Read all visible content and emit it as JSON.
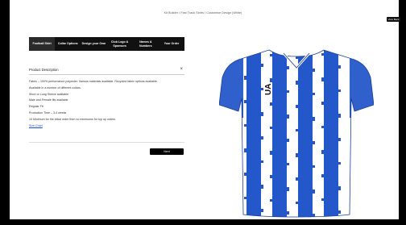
{
  "header": {
    "breadcrumb": "Kit Builder / Fast Track Shirts / Customise Design (White)",
    "back_button": "View Back"
  },
  "tabs": [
    {
      "label": "Football Shirt",
      "active": true
    },
    {
      "label": "Collar Options",
      "active": false
    },
    {
      "label": "Design your Own",
      "active": false
    },
    {
      "label": "Club Logo & Sponsors",
      "active": false
    },
    {
      "label": "Names & Numbers",
      "active": false
    },
    {
      "label": "Your Order",
      "active": false
    }
  ],
  "panel": {
    "title": "Product Description",
    "close_glyph": "×",
    "lines": [
      "Fabric – 100% performance polyester. Various materials available. Recycled fabric options available.",
      "Available in a number of different collars.",
      "Short or Long Sleeve available",
      "Male and Female fits available",
      "Regular Fit",
      "Production Time – 3-4 weeks",
      "10 Minimum for the initial order then no minimums for top up orders."
    ],
    "size_chart_link": "Size Chart"
  },
  "actions": {
    "next_label": "Next"
  },
  "product": {
    "stripe_color": "#2457c9",
    "base_color": "#ffffff",
    "crest_text": "UA"
  }
}
